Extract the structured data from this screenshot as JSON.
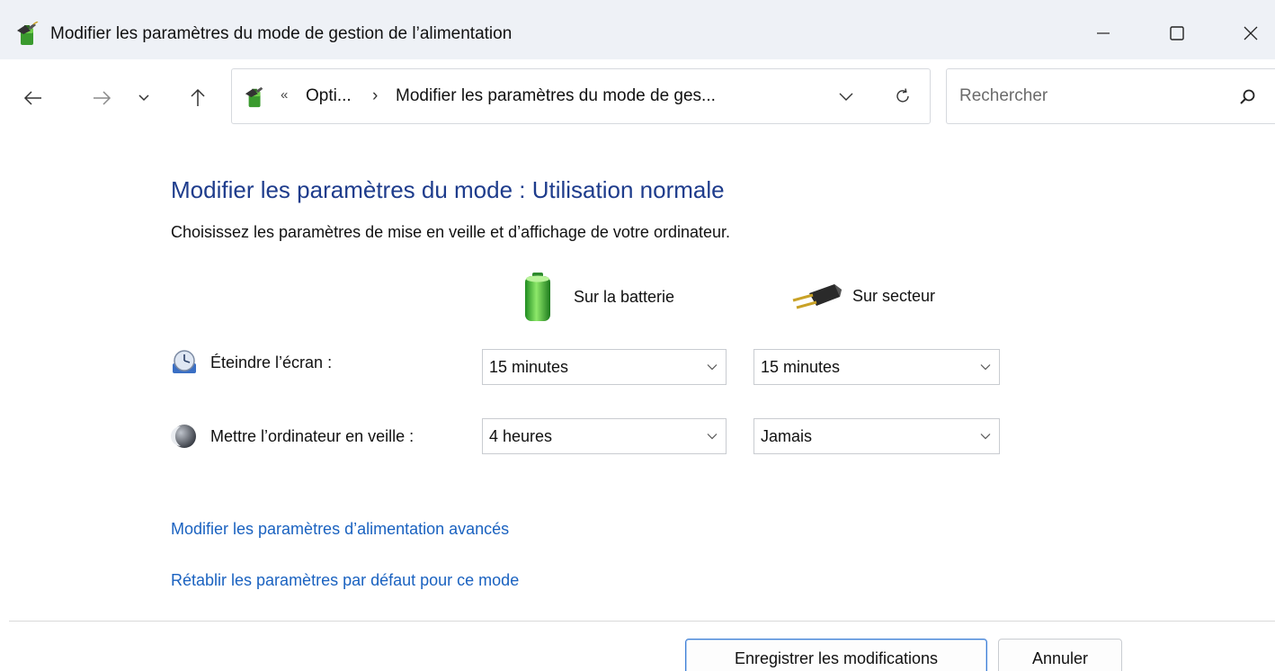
{
  "window": {
    "title": "Modifier les paramètres du mode de gestion de l’alimentation",
    "app_icon": "power-options-icon",
    "controls": {
      "minimize": "minimize-icon",
      "maximize": "maximize-icon",
      "close": "close-icon"
    }
  },
  "nav": {
    "back": "back-arrow-icon",
    "forward": "forward-arrow-icon",
    "recent": "chevron-down-icon",
    "up": "up-arrow-icon"
  },
  "address": {
    "overflow": "«",
    "crumbs": [
      "Opti...",
      "Modifier les paramètres du mode de ges..."
    ],
    "separator": "›"
  },
  "search": {
    "placeholder": "Rechercher",
    "value": ""
  },
  "content": {
    "heading": "Modifier les paramètres du mode : Utilisation normale",
    "subtitle": "Choisissez les paramètres de mise en veille et d’affichage de votre ordinateur.",
    "columns": {
      "battery": "Sur la batterie",
      "plugged": "Sur secteur"
    },
    "rows": {
      "display": {
        "label": "Éteindre l’écran :",
        "battery_value": "15 minutes",
        "plugged_value": "15 minutes"
      },
      "sleep": {
        "label": "Mettre l’ordinateur en veille :",
        "battery_value": "4 heures",
        "plugged_value": "Jamais"
      }
    },
    "links": {
      "advanced": "Modifier les paramètres d’alimentation avancés",
      "restore": "Rétablir les paramètres par défaut pour ce mode"
    }
  },
  "buttons": {
    "save": "Enregistrer les modifications",
    "cancel": "Annuler"
  },
  "colors": {
    "heading": "#1e3c8c",
    "link": "#1a62c0",
    "titlebar_bg": "#eef1f6"
  }
}
